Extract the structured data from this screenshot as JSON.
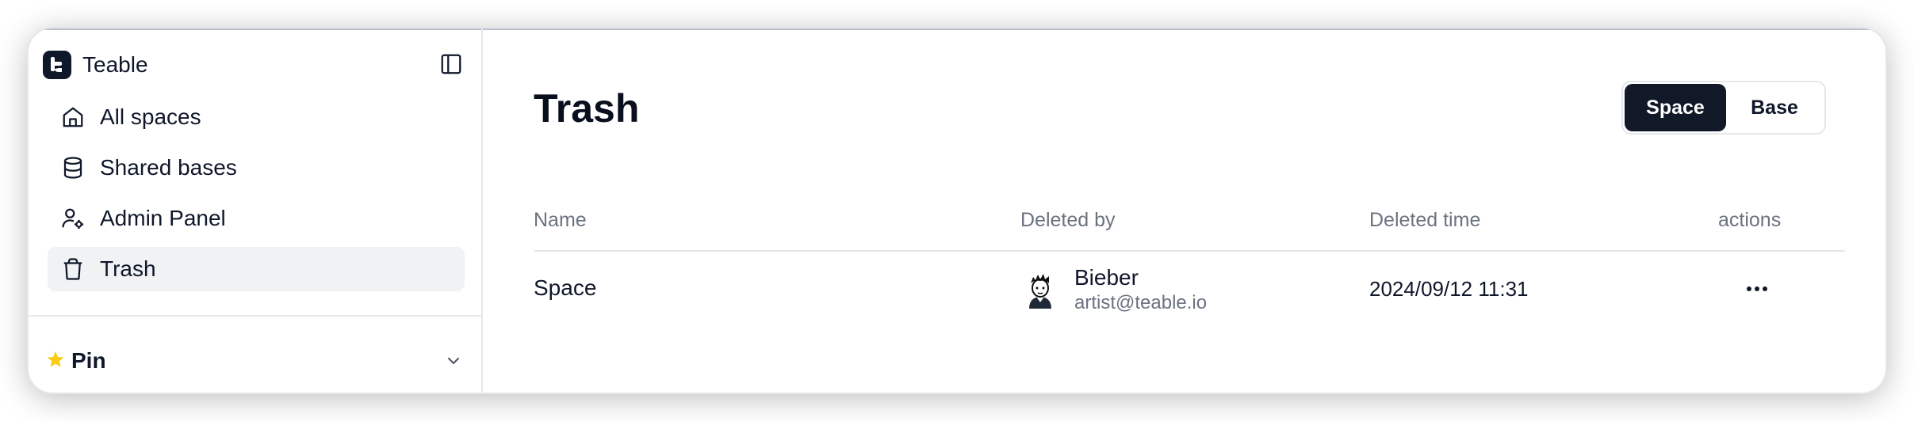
{
  "app": {
    "name": "Teable"
  },
  "sidebar": {
    "items": [
      {
        "label": "All spaces",
        "icon": "home-icon",
        "active": false
      },
      {
        "label": "Shared bases",
        "icon": "database-icon",
        "active": false
      },
      {
        "label": "Admin Panel",
        "icon": "user-cog-icon",
        "active": false
      },
      {
        "label": "Trash",
        "icon": "trash-icon",
        "active": true
      }
    ],
    "pin": {
      "label": "Pin",
      "icon": "star-icon",
      "star_color": "#facc15"
    }
  },
  "main": {
    "title": "Trash",
    "toggle": {
      "options": [
        "Space",
        "Base"
      ],
      "selected": "Space"
    },
    "table": {
      "columns": [
        "Name",
        "Deleted by",
        "Deleted time",
        "actions"
      ],
      "rows": [
        {
          "name": "Space",
          "deleted_by": {
            "name": "Bieber",
            "email": "artist@teable.io"
          },
          "deleted_time": "2024/09/12 11:31",
          "actions_icon": "more-horizontal-icon"
        }
      ]
    }
  },
  "colors": {
    "accent": "#111827",
    "muted_text": "#6b7280",
    "active_bg": "#f1f2f4",
    "border": "#e5e7eb"
  }
}
